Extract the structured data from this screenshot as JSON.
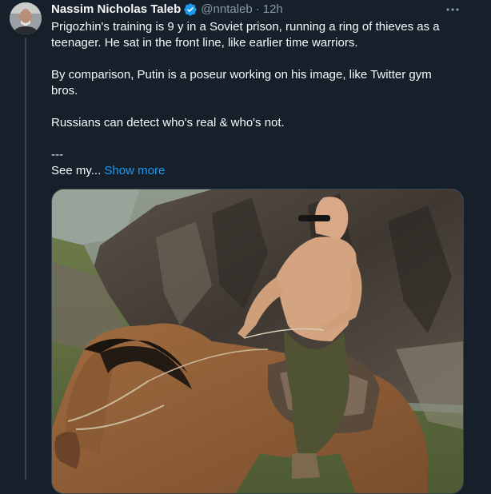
{
  "author": {
    "name": "Nassim Nicholas Taleb",
    "handle": "@nntaleb",
    "separator": "·",
    "time": "12h"
  },
  "icons": {
    "verified": "verified-badge-icon",
    "more": "more-options-icon",
    "avatar": "author-avatar"
  },
  "tweet": {
    "lines": [
      "Prigozhin's training is 9 y in a Soviet prison, running a ring of thieves as a teenager. He sat in the front line, like earlier time warriors.",
      "By comparison, Putin is a poseur working on his image, like Twitter gym bros.",
      "Russians can detect who's real & who's not.",
      "---"
    ],
    "see_my": "See my...",
    "show_more": "Show more"
  },
  "media": {
    "description_alt": "Shirtless man in sunglasses riding a brown horse in front of rocky cliffs"
  },
  "colors": {
    "background": "#15202b",
    "text": "#f7f9f9",
    "secondary": "#8b98a5",
    "link": "#1d9bf0",
    "verified": "#1d9bf0",
    "border": "#38444d"
  }
}
